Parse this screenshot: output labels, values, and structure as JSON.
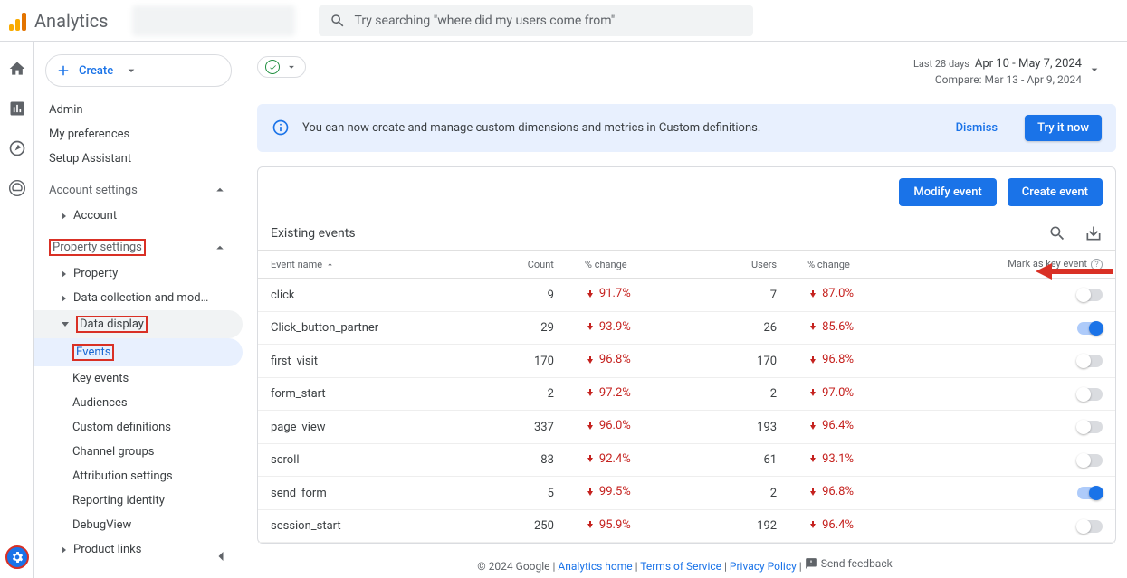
{
  "app": {
    "title": "Analytics"
  },
  "search": {
    "placeholder": "Try searching \"where did my users come from\""
  },
  "create_label": "Create",
  "sidebar": {
    "admin": "Admin",
    "my_prefs": "My preferences",
    "setup_assistant": "Setup Assistant",
    "account_settings": "Account settings",
    "account": "Account",
    "property_settings": "Property settings",
    "property": "Property",
    "data_collection": "Data collection and modifica...",
    "data_display": "Data display",
    "events": "Events",
    "key_events": "Key events",
    "audiences": "Audiences",
    "custom_definitions": "Custom definitions",
    "channel_groups": "Channel groups",
    "attribution": "Attribution settings",
    "reporting_identity": "Reporting identity",
    "debugview": "DebugView",
    "product_links": "Product links"
  },
  "date": {
    "range_lbl": "Last 28 days",
    "range": "Apr 10 - May 7, 2024",
    "compare": "Compare: Mar 13 - Apr 9, 2024"
  },
  "banner": {
    "text": "You can now create and manage custom dimensions and metrics in Custom definitions.",
    "dismiss": "Dismiss",
    "try": "Try it now"
  },
  "card": {
    "modify": "Modify event",
    "create": "Create event",
    "existing": "Existing events",
    "cols": {
      "name": "Event name",
      "count": "Count",
      "change1": "% change",
      "users": "Users",
      "change2": "% change",
      "mark": "Mark as key event"
    },
    "rows": [
      {
        "name": "click",
        "count": "9",
        "c1": "91.7%",
        "users": "7",
        "c2": "87.0%",
        "on": false
      },
      {
        "name": "Click_button_partner",
        "count": "29",
        "c1": "93.9%",
        "users": "26",
        "c2": "85.6%",
        "on": true
      },
      {
        "name": "first_visit",
        "count": "170",
        "c1": "96.8%",
        "users": "170",
        "c2": "96.8%",
        "on": false
      },
      {
        "name": "form_start",
        "count": "2",
        "c1": "97.2%",
        "users": "2",
        "c2": "97.0%",
        "on": false
      },
      {
        "name": "page_view",
        "count": "337",
        "c1": "96.0%",
        "users": "193",
        "c2": "96.4%",
        "on": false
      },
      {
        "name": "scroll",
        "count": "83",
        "c1": "92.4%",
        "users": "61",
        "c2": "93.1%",
        "on": false
      },
      {
        "name": "send_form",
        "count": "5",
        "c1": "99.5%",
        "users": "2",
        "c2": "96.8%",
        "on": true
      },
      {
        "name": "session_start",
        "count": "250",
        "c1": "95.9%",
        "users": "192",
        "c2": "96.4%",
        "on": false
      }
    ]
  },
  "footer": {
    "copyright": "© 2024 Google",
    "home": "Analytics home",
    "terms": "Terms of Service",
    "privacy": "Privacy Policy",
    "feedback": "Send feedback"
  }
}
